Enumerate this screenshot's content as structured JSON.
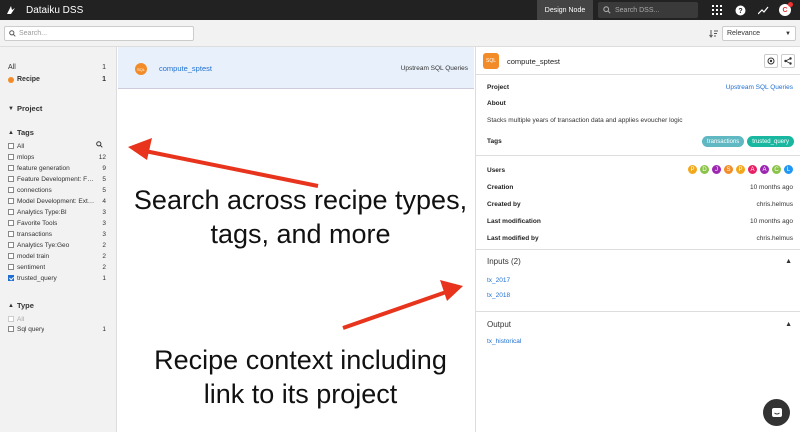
{
  "topbar": {
    "app_title": "Dataiku DSS",
    "design_node": "Design Node",
    "search_placeholder": "Search DSS...",
    "avatar_initial": "C"
  },
  "search": {
    "placeholder": "Search...",
    "sort_value": "Relevance"
  },
  "sidebar": {
    "all_label": "All",
    "all_count": "1",
    "recipe_label": "Recipe",
    "recipe_count": "1",
    "project_header": "Project",
    "tags_header": "Tags",
    "tags": [
      {
        "label": "All",
        "count": "",
        "checked": false
      },
      {
        "label": "mlops",
        "count": "12",
        "checked": false
      },
      {
        "label": "feature generation",
        "count": "9",
        "checked": false
      },
      {
        "label": "Feature Development: F…",
        "count": "5",
        "checked": false
      },
      {
        "label": "connections",
        "count": "5",
        "checked": false
      },
      {
        "label": "Model Development: Ext…",
        "count": "4",
        "checked": false
      },
      {
        "label": "Analytics Type:BI",
        "count": "3",
        "checked": false
      },
      {
        "label": "Favorite Tools",
        "count": "3",
        "checked": false
      },
      {
        "label": "transactions",
        "count": "3",
        "checked": false
      },
      {
        "label": "Analytics Tye:Geo",
        "count": "2",
        "checked": false
      },
      {
        "label": "model train",
        "count": "2",
        "checked": false
      },
      {
        "label": "sentiment",
        "count": "2",
        "checked": false
      },
      {
        "label": "trusted_query",
        "count": "1",
        "checked": true
      }
    ],
    "type_header": "Type",
    "type_all": "All",
    "type_sql": "Sql query",
    "type_sql_count": "1"
  },
  "result": {
    "icon_text": "SQL",
    "name": "compute_sptest",
    "project": "Upstream SQL Queries"
  },
  "details": {
    "title": "compute_sptest",
    "icon_text": "SQL",
    "project_label": "Project",
    "project_value": "Upstream SQL Queries",
    "about_label": "About",
    "about_text": "Stacks multiple years of transaction data and applies evoucher logic",
    "tags_label": "Tags",
    "tags": [
      {
        "label": "transactions",
        "color": "#5fb8c2"
      },
      {
        "label": "trusted_query",
        "color": "#1ab7a0"
      }
    ],
    "users_label": "Users",
    "users": [
      {
        "initial": "P",
        "color": "#f2a81d"
      },
      {
        "initial": "D",
        "color": "#8bc34a"
      },
      {
        "initial": "J",
        "color": "#9c27b0"
      },
      {
        "initial": "S",
        "color": "#f28c28"
      },
      {
        "initial": "P",
        "color": "#f2a81d"
      },
      {
        "initial": "A",
        "color": "#e91e63"
      },
      {
        "initial": "A",
        "color": "#9c27b0"
      },
      {
        "initial": "C",
        "color": "#8bc34a"
      },
      {
        "initial": "L",
        "color": "#2196f3"
      }
    ],
    "creation_label": "Creation",
    "creation_value": "10 months ago",
    "created_by_label": "Created by",
    "created_by_value": "chris.helmus",
    "last_mod_label": "Last modification",
    "last_mod_value": "10 months ago",
    "last_mod_by_label": "Last modified by",
    "last_mod_by_value": "chris.helmus",
    "inputs_title": "Inputs (2)",
    "inputs": [
      "tx_2017",
      "tx_2018"
    ],
    "output_title": "Output",
    "outputs": [
      "tx_historical"
    ]
  },
  "annotations": {
    "top_line1": "Search across recipe types,",
    "top_line2": "tags, and more",
    "bottom_line1": "Recipe context including",
    "bottom_line2": "link to its project"
  },
  "colors": {
    "accent": "#1f6fd1",
    "recipe_orange": "#f28c28",
    "arrow_red": "#e8341c"
  }
}
